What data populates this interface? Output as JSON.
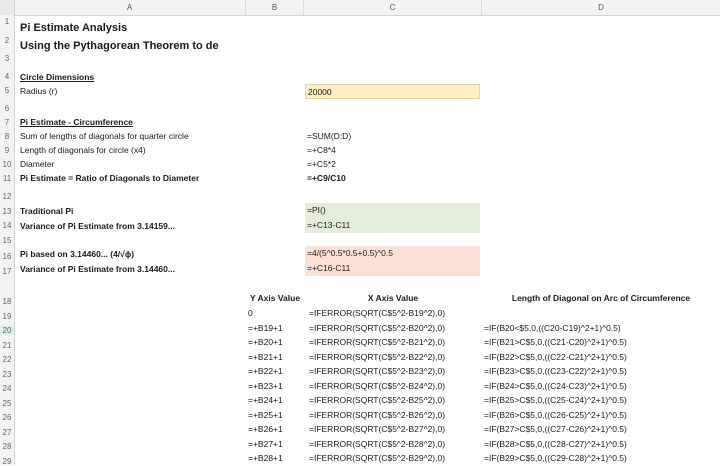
{
  "columns": [
    "A",
    "B",
    "C",
    "D"
  ],
  "rows": [
    "1",
    "2",
    "3",
    "4",
    "5",
    "6",
    "7",
    "8",
    "9",
    "10",
    "11",
    "12",
    "13",
    "14",
    "15",
    "16",
    "17",
    "18",
    "19",
    "20",
    "21",
    "22",
    "23",
    "24",
    "25",
    "26",
    "27",
    "28",
    "29"
  ],
  "title": "Pi Estimate Analysis",
  "subtitle": "Using the Pythagorean Theorem to de",
  "circle_section": "Circle Dimensions",
  "radius_label": "Radius (r)",
  "radius_value": "20000",
  "circ_section": "Pi Estimate - Circumference",
  "sum_label": "Sum of lengths of diagonals for quarter circle",
  "sum_formula": "=SUM(D:D)",
  "len_label": "Length of diagonals for circle (x4)",
  "len_formula": "=+C8*4",
  "diam_label": "Diameter",
  "diam_formula": "=+C5*2",
  "ratio_label": "Pi Estimate = Ratio of Diagonals to Diameter",
  "ratio_formula": "=+C9/C10",
  "trad_label": "Traditional Pi",
  "trad_formula": "=PI()",
  "var1_label": "Variance of Pi Estimate from 3.14159...",
  "var1_formula": "=+C13-C11",
  "pi2_label": "Pi based on 3.14460... (4/√ϕ)",
  "pi2_formula": "=4/(5^0.5*0.5+0.5)^0.5",
  "var2_label": "Variance of Pi Estimate from 3.14460...",
  "var2_formula": "=+C16-C11",
  "table_headers": {
    "y": "Y Axis Value",
    "x": "X Axis Value",
    "len": "Length of Diagonal on Arc of Circumference"
  },
  "table_rows": [
    {
      "y": "0",
      "x": "=IFERROR(SQRT(C$5^2-B19^2),0)",
      "d": ""
    },
    {
      "y": "=+B19+1",
      "x": "=IFERROR(SQRT(C$5^2-B20^2),0)",
      "d": "=IF(B20<$5,0,((C20-C19)^2+1)^0.5)"
    },
    {
      "y": "=+B20+1",
      "x": "=IFERROR(SQRT(C$5^2-B21^2),0)",
      "d": "=IF(B21>C$5,0,((C21-C20)^2+1)^0.5)"
    },
    {
      "y": "=+B21+1",
      "x": "=IFERROR(SQRT(C$5^2-B22^2),0)",
      "d": "=IF(B22>C$5,0,((C22-C21)^2+1)^0.5)"
    },
    {
      "y": "=+B22+1",
      "x": "=IFERROR(SQRT(C$5^2-B23^2),0)",
      "d": "=IF(B23>C$5,0,((C23-C22)^2+1)^0.5)"
    },
    {
      "y": "=+B23+1",
      "x": "=IFERROR(SQRT(C$5^2-B24^2),0)",
      "d": "=IF(B24>C$5,0,((C24-C23)^2+1)^0.5)"
    },
    {
      "y": "=+B24+1",
      "x": "=IFERROR(SQRT(C$5^2-B25^2),0)",
      "d": "=IF(B25>C$5,0,((C25-C24)^2+1)^0.5)"
    },
    {
      "y": "=+B25+1",
      "x": "=IFERROR(SQRT(C$5^2-B26^2),0)",
      "d": "=IF(B26>C$5,0,((C26-C25)^2+1)^0.5)"
    },
    {
      "y": "=+B26+1",
      "x": "=IFERROR(SQRT(C$5^2-B27^2),0)",
      "d": "=IF(B27>C$5,0,((C27-C26)^2+1)^0.5)"
    },
    {
      "y": "=+B27+1",
      "x": "=IFERROR(SQRT(C$5^2-B28^2),0)",
      "d": "=IF(B28>C$5,0,((C28-C27)^2+1)^0.5)"
    },
    {
      "y": "=+B28+1",
      "x": "=IFERROR(SQRT(C$5^2-B29^2),0)",
      "d": "=IF(B29>C$5,0,((C29-C28)^2+1)^0.5)"
    }
  ],
  "colors": {
    "radius_fill": "#fdeec4",
    "green_fill": "#e3efda",
    "orange_fill": "#fbe1d5",
    "header_bg": "#f3f3f3",
    "selected_row": "#2f7d4f"
  }
}
